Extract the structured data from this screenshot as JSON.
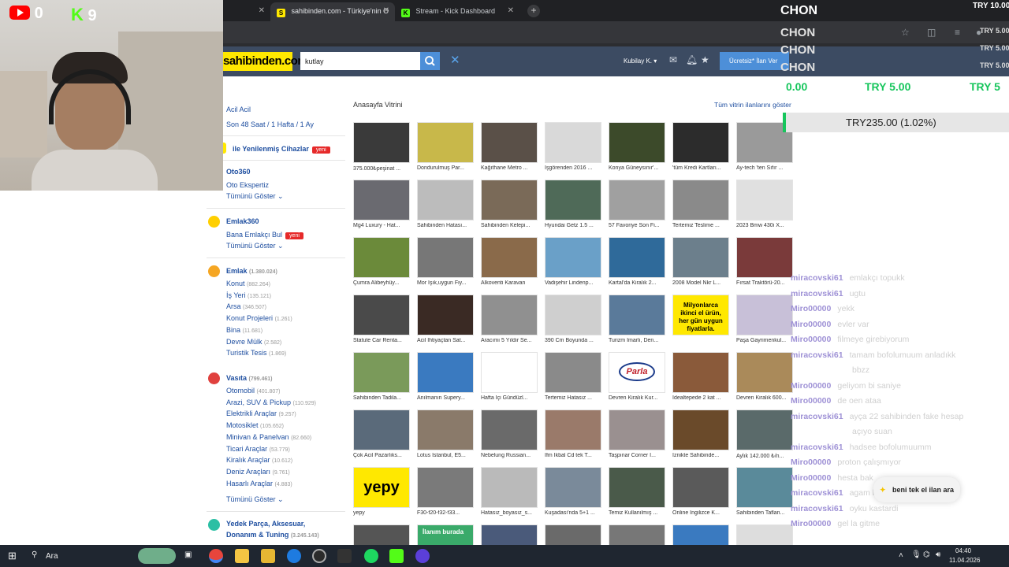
{
  "browser": {
    "tabs": [
      {
        "title": "sahibinden.com - Türkiye'nin O",
        "favicon": "S",
        "favicon_color": "#ffe800"
      },
      {
        "title": "Stream - Kick Dashboard",
        "favicon": "K",
        "favicon_color": "#53fc18"
      }
    ],
    "new_tab": "+",
    "close": "✕"
  },
  "site": {
    "logo": "sahibinden.com",
    "search_value": "kutlay",
    "user": "Kubilay K.",
    "post_ad": "Ücretsiz* İlan Ver"
  },
  "menu": {
    "quick_links": [
      "Acil Acil"
    ],
    "time_links": [
      "Son 48 Saat",
      "1 Hafta",
      "1 Ay"
    ],
    "renewed": "ile Yenilenmiş Cihazlar",
    "badge_new": "yeni",
    "oto360": "Oto360",
    "oto_ekspertiz": "Oto Ekspertiz",
    "show_all": "Tümünü Göster",
    "emlak360": "Emlak360",
    "emlakci": "Bana Emlakçı Bul",
    "emlak": {
      "label": "Emlak",
      "count": "(1.380.024)",
      "items": [
        {
          "label": "Konut",
          "count": "(882.264)"
        },
        {
          "label": "İş Yeri",
          "count": "(135.121)"
        },
        {
          "label": "Arsa",
          "count": "(346.507)"
        },
        {
          "label": "Konut Projeleri",
          "count": "(1.261)"
        },
        {
          "label": "Bina",
          "count": "(11.681)"
        },
        {
          "label": "Devre Mülk",
          "count": "(2.582)"
        },
        {
          "label": "Turistik Tesis",
          "count": "(1.869)"
        }
      ]
    },
    "vasita": {
      "label": "Vasıta",
      "count": "(799.461)",
      "items": [
        {
          "label": "Otomobil",
          "count": "(401.807)"
        },
        {
          "label": "Arazi, SUV & Pickup",
          "count": "(110.929)"
        },
        {
          "label": "Elektrikli Araçlar",
          "count": "(9.257)"
        },
        {
          "label": "Motosiklet",
          "count": "(105.652)"
        },
        {
          "label": "Minivan & Panelvan",
          "count": "(82.660)"
        },
        {
          "label": "Ticari Araçlar",
          "count": "(53.779)"
        },
        {
          "label": "Kiralık Araçlar",
          "count": "(10.612)"
        },
        {
          "label": "Deniz Araçları",
          "count": "(9.761)"
        },
        {
          "label": "Hasarlı Araçlar",
          "count": "(4.883)"
        }
      ]
    },
    "yedek": {
      "label": "Yedek Parça, Aksesuar,",
      "label2": "Donanım & Tuning",
      "count": "(3.245.143)"
    }
  },
  "showcase": {
    "title": "Anasayfa Vitrini",
    "show_all": "Tüm vitrin ilanlarını göster",
    "items": [
      "375.000₺peşinat ...",
      "Dondurulmuş Par...",
      "Kağıthane Metro ...",
      "İşgörenden 2016 ...",
      "Konya Güneysınır'...",
      "'tüm Kredi Kartları...",
      "Ay-tech 'ten Sıfır ...",
      "Mg4 Luxury - Hat...",
      "Sahibinden Hatası...",
      "Sahibinden Kelepi...",
      "Hyundai Getz 1.5 ...",
      "57 Favoriye Son Fi...",
      "Tertemiz Teslime ...",
      "2023 Bmw 430i X...",
      "Çumra Alibeyhüy...",
      "Mor Işık,uygun Fiy...",
      "Alkoventi Karavan",
      "Vadişehir Lindenp...",
      "Kartal'da Kiralık 2...",
      "2008 Model Nkr L...",
      "Fırsat Traktörü-20...",
      "Statute Car Renta...",
      "Acil İhtiyaçtan Sat...",
      "Aracımı 5 Yıldır Se...",
      "390 Cm Boyunda ...",
      "Turizm İmarlı, Den...",
      "Milyonlarca ikinci el ürün, her gün uygun fiyatlarla.",
      "Paşa Gayrimenkul...",
      "Sahibinden Tadila...",
      "Anılmanın Supery...",
      "Hafta İçi Gündüzl...",
      "Tertemiz Hatasız ...",
      "Devren Kiralık Kur...",
      "İdealtepede 2 kat ...",
      "Devren Kiralık 600...",
      "Çok Acil Pazarlıks...",
      "Lotus İstanbul, E5...",
      "Nebelung Russian...",
      "İfm İkbal Cd tek T...",
      "Taşpınar Corner I...",
      "İznikte Sahibinde...",
      "Aylık 142.000 ₺/n...",
      "yepy",
      "F30-f20-f32-f33...",
      "Hatasız_boyasız_s...",
      "Kuşadası'nda 5+1 ...",
      "Temiz Kullanılmış ...",
      "Online İngilizce K...",
      "Sahibinden Taflan..."
    ],
    "banner_text": "Milyonlarca ikinci el ürün, her gün uygun fiyatlarla.",
    "parla": "Parla",
    "yepy": "yepy",
    "ilan_burada": "İlanım burada"
  },
  "stream": {
    "youtube_count": "0",
    "kick_count": "9",
    "chon": [
      "CHON",
      "CHON",
      "CHON",
      "CHON"
    ],
    "try_lines": [
      "TRY 10.00",
      "TRY 5.00",
      "TRY 5.00",
      "TRY 5.00"
    ],
    "ticker": [
      "0.00",
      "TRY 5.00",
      "TRY 5"
    ],
    "price": "TRY235.00 (1.02%)",
    "chat": [
      {
        "user": "miracovski61",
        "msg": "emlakçı topukk"
      },
      {
        "user": "miracovski61",
        "msg": "ugtu"
      },
      {
        "user": "Miro00000",
        "msg": "yekk"
      },
      {
        "user": "Miro00000",
        "msg": "evler var"
      },
      {
        "user": "Miro00000",
        "msg": "filmeye girebiyorum"
      },
      {
        "user": "miracovski61",
        "msg": "tamam bofolumuum anladıkk"
      },
      {
        "user": "",
        "msg": "bbzz"
      },
      {
        "user": "Miro00000",
        "msg": "geliyom bi saniye"
      },
      {
        "user": "Miro00000",
        "msg": "de oen ataa"
      },
      {
        "user": "miracovski61",
        "msg": "ayça 22 sahibinden fake hesap"
      },
      {
        "user": "",
        "msg": "açıyo suan"
      },
      {
        "user": "miracovski61",
        "msg": "hadsee bofolumuumm"
      },
      {
        "user": "Miro00000",
        "msg": "proton çalışmıyor"
      },
      {
        "user": "Miro00000",
        "msg": "hesta bak"
      },
      {
        "user": "miracovski61",
        "msg": "agam beni tek el ilan ara"
      },
      {
        "user": "miracovski61",
        "msg": "oyku kastardi"
      },
      {
        "user": "Miro00000",
        "msg": "gel la gitme"
      }
    ],
    "toast": "beni tek el ilan ara"
  },
  "taskbar": {
    "search": "Ara",
    "time": "04:40",
    "date": "11.04.2026"
  }
}
